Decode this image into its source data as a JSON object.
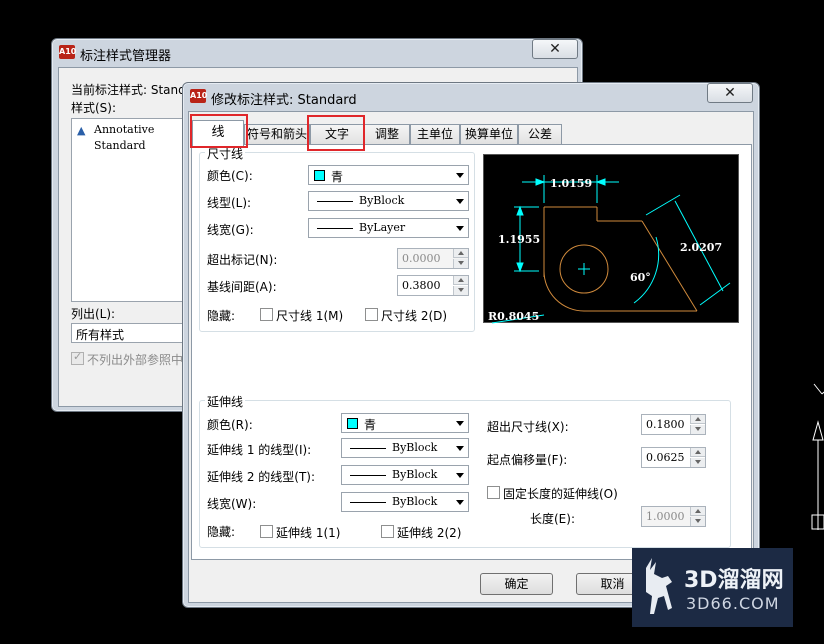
{
  "back_window": {
    "title": "标注样式管理器",
    "current_style_label": "当前标注样式: Stand",
    "styles_label": "样式(S):",
    "styles": [
      "Annotative",
      "Standard"
    ],
    "list_label": "列出(L):",
    "list_value": "所有样式",
    "exclude_xref_label": "不列出外部参照中"
  },
  "dialog": {
    "title": "修改标注样式: Standard",
    "close_glyph": "✕",
    "tabs": [
      "线",
      "符号和箭头",
      "文字",
      "调整",
      "主单位",
      "换算单位",
      "公差"
    ],
    "active_tab": "线"
  },
  "dimline": {
    "group_title": "尺寸线",
    "color_label": "颜色(C):",
    "color_value": "青",
    "linetype_label": "线型(L):",
    "linetype_value": "ByBlock",
    "lineweight_label": "线宽(G):",
    "lineweight_value": "ByLayer",
    "extend_ticks_label": "超出标记(N):",
    "extend_ticks_value": "0.0000",
    "baseline_spacing_label": "基线间距(A):",
    "baseline_spacing_value": "0.3800",
    "suppress_label": "隐藏:",
    "suppress_1_label": "尺寸线 1(M)",
    "suppress_2_label": "尺寸线 2(D)"
  },
  "extline": {
    "group_title": "延伸线",
    "color_label": "颜色(R):",
    "color_value": "青",
    "linetype1_label": "延伸线 1 的线型(I):",
    "linetype1_value": "ByBlock",
    "linetype2_label": "延伸线 2 的线型(T):",
    "linetype2_value": "ByBlock",
    "lineweight_label": "线宽(W):",
    "lineweight_value": "ByBlock",
    "suppress_label": "隐藏:",
    "suppress_1_label": "延伸线 1(1)",
    "suppress_2_label": "延伸线 2(2)",
    "extend_beyond_label": "超出尺寸线(X):",
    "extend_beyond_value": "0.1800",
    "offset_origin_label": "起点偏移量(F):",
    "offset_origin_value": "0.0625",
    "fixed_length_label": "固定长度的延伸线(O)",
    "length_label": "长度(E):",
    "length_value": "1.0000"
  },
  "preview": {
    "dim_top": "1.0159",
    "dim_left": "1.1955",
    "dim_right": "2.0207",
    "dim_angle": "60°",
    "dim_radius": "R0.8045"
  },
  "buttons": {
    "ok": "确定",
    "cancel": "取消"
  },
  "watermark": {
    "brand": "3D溜溜网",
    "url": "3D66.COM"
  },
  "colors": {
    "cyan": "#00ffff",
    "highlight": "#e0262a",
    "preview_dim": "#00ffff",
    "preview_geom": "#d08a3c"
  }
}
